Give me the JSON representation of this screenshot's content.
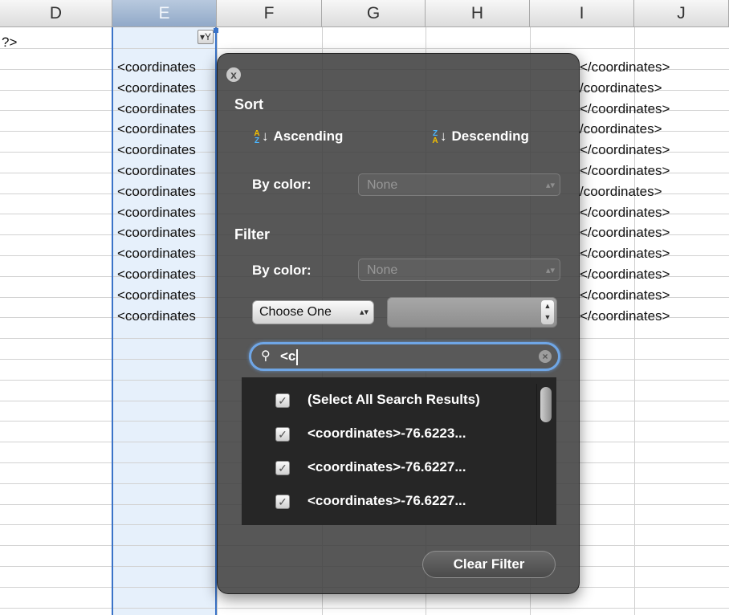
{
  "columns": [
    "D",
    "E",
    "F",
    "G",
    "H",
    "I",
    "J"
  ],
  "cells": {
    "d_first": "?>",
    "e_rows": [
      "<coordinates",
      "<coordinates",
      "<coordinates",
      "<coordinates",
      "<coordinates",
      "<coordinates",
      "<coordinates",
      "<coordinates",
      "<coordinates",
      "<coordinates",
      "<coordinates",
      "<coordinates",
      "<coordinates"
    ],
    "j_rows": [
      "</coordinates>",
      "/coordinates>",
      "</coordinates>",
      "/coordinates>",
      "</coordinates>",
      "</coordinates>",
      "/coordinates>",
      "</coordinates>",
      "</coordinates>",
      "</coordinates>",
      "</coordinates>",
      "</coordinates>",
      "</coordinates>"
    ]
  },
  "filter_popover": {
    "close_icon": "x",
    "sort": {
      "title": "Sort",
      "ascending_label": "Ascending",
      "descending_label": "Descending",
      "by_color_label": "By color:",
      "by_color_value": "None"
    },
    "filter": {
      "title": "Filter",
      "by_color_label": "By color:",
      "by_color_value": "None",
      "choose_label": "Choose One"
    },
    "search": {
      "value": "<c",
      "icon": "search-icon"
    },
    "results": [
      {
        "label": "(Select All Search Results)",
        "checked": true
      },
      {
        "label": "<coordinates>-76.6223...",
        "checked": true
      },
      {
        "label": "<coordinates>-76.6227...",
        "checked": true
      },
      {
        "label": "<coordinates>-76.6227...",
        "checked": true
      }
    ],
    "clear_filter_label": "Clear Filter"
  },
  "colors": {
    "selection": "#3a73c8",
    "popover_bg": "#3e3e3e",
    "search_focus": "#6fa6e6",
    "az_a": "#f4c000",
    "az_z": "#4bb6ff"
  }
}
